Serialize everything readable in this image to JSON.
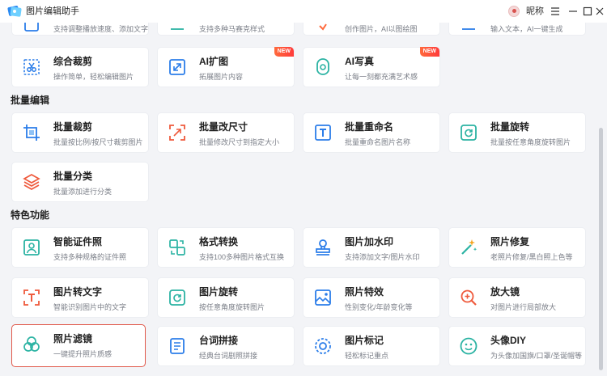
{
  "titlebar": {
    "title": "图片编辑助手",
    "user_name": "昵称"
  },
  "sections": {
    "batch": "批量编辑",
    "special": "特色功能"
  },
  "cards_top_partial": [
    {
      "desc": "支持调整播放速度、添加文字",
      "icon": "video-speed-icon"
    },
    {
      "desc": "支持多种马赛克样式",
      "icon": "mosaic-icon"
    },
    {
      "desc": "创作图片，AI以图绘图",
      "icon": "ai-draw-icon"
    },
    {
      "desc": "输入文本，AI一键生成",
      "icon": "ai-text-icon"
    }
  ],
  "cards_row1": [
    {
      "title": "综合裁剪",
      "desc": "操作简单，轻松编辑图片",
      "icon": "crop-icon",
      "badge": ""
    },
    {
      "title": "AI扩图",
      "desc": "拓展图片内容",
      "icon": "expand-icon",
      "badge": "NEW"
    },
    {
      "title": "AI写真",
      "desc": "让每一刻都充满艺术感",
      "icon": "portrait-icon",
      "badge": "NEW"
    }
  ],
  "cards_batch": [
    {
      "title": "批量裁剪",
      "desc": "批量按比例/按尺寸裁剪图片",
      "icon": "batch-crop-icon"
    },
    {
      "title": "批量改尺寸",
      "desc": "批量修改尺寸到指定大小",
      "icon": "resize-icon"
    },
    {
      "title": "批量重命名",
      "desc": "批量重命名图片名称",
      "icon": "rename-icon"
    },
    {
      "title": "批量旋转",
      "desc": "批量按任意角度旋转图片",
      "icon": "rotate-icon"
    },
    {
      "title": "批量分类",
      "desc": "批量添加进行分类",
      "icon": "layers-icon"
    }
  ],
  "cards_special": [
    {
      "title": "智能证件照",
      "desc": "支持多种规格的证件照",
      "icon": "id-photo-icon"
    },
    {
      "title": "格式转换",
      "desc": "支持100多种图片格式互换",
      "icon": "convert-icon"
    },
    {
      "title": "图片加水印",
      "desc": "支持添加文字/图片水印",
      "icon": "stamp-icon"
    },
    {
      "title": "照片修复",
      "desc": "老照片修复/黑白照上色等",
      "icon": "magic-wand-icon"
    },
    {
      "title": "图片转文字",
      "desc": "智能识别图片中的文字",
      "icon": "ocr-icon"
    },
    {
      "title": "图片旋转",
      "desc": "按任意角度旋转图片",
      "icon": "rotate-image-icon"
    },
    {
      "title": "照片特效",
      "desc": "性别变化/年龄变化等",
      "icon": "effect-icon"
    },
    {
      "title": "放大镜",
      "desc": "对图片进行局部放大",
      "icon": "magnifier-icon"
    },
    {
      "title": "照片滤镜",
      "desc": "一键提升照片质感",
      "icon": "filter-icon"
    },
    {
      "title": "台词拼接",
      "desc": "经典台词剧照拼接",
      "icon": "subtitle-icon"
    },
    {
      "title": "图片标记",
      "desc": "轻松标记重点",
      "icon": "marker-icon"
    },
    {
      "title": "头像DIY",
      "desc": "为头像加国旗/口罩/圣诞帽等",
      "icon": "avatar-diy-icon"
    }
  ],
  "colors": {
    "accent": "#1f7de6",
    "badge": "#ff4b3a",
    "selected_border": "#e0584a"
  }
}
